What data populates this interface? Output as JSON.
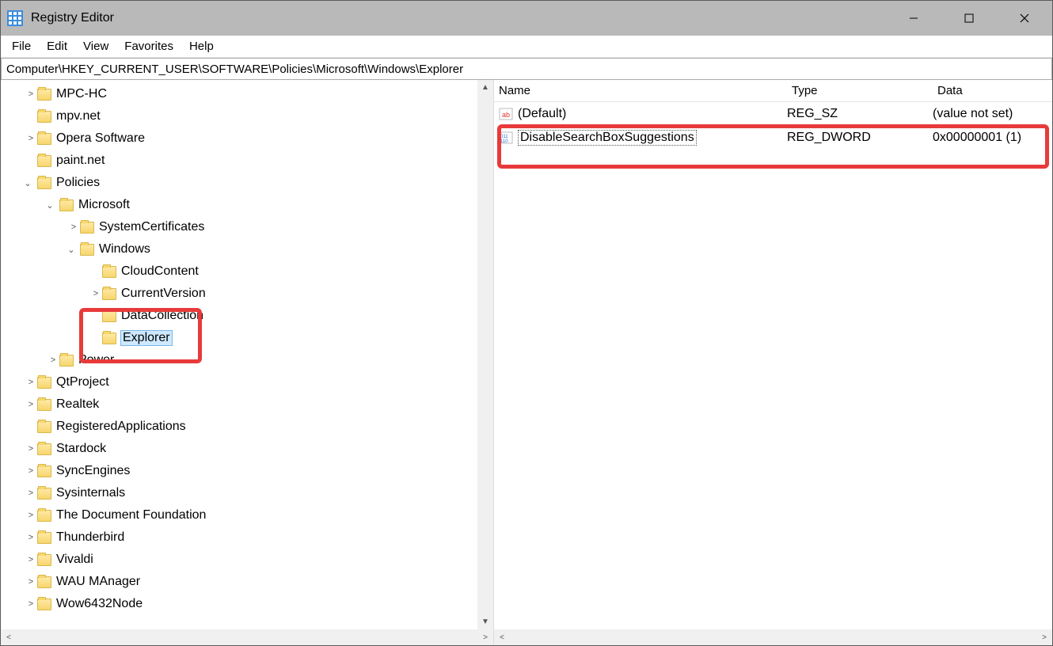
{
  "titlebar": {
    "title": "Registry Editor"
  },
  "menu": {
    "file": "File",
    "edit": "Edit",
    "view": "View",
    "favorites": "Favorites",
    "help": "Help"
  },
  "address": "Computer\\HKEY_CURRENT_USER\\SOFTWARE\\Policies\\Microsoft\\Windows\\Explorer",
  "tree": {
    "mpchc": "MPC-HC",
    "mpvnet": "mpv.net",
    "opera": "Opera Software",
    "paintnet": "paint.net",
    "policies": "Policies",
    "microsoft": "Microsoft",
    "syscert": "SystemCertificates",
    "windows": "Windows",
    "cloud": "CloudContent",
    "currver": "CurrentVersion",
    "datacoll": "DataCollection",
    "explorer": "Explorer",
    "power": "Power",
    "qtproject": "QtProject",
    "realtek": "Realtek",
    "regapps": "RegisteredApplications",
    "stardock": "Stardock",
    "syncengines": "SyncEngines",
    "sysinternals": "Sysinternals",
    "tdf": "The Document Foundation",
    "thunderbird": "Thunderbird",
    "vivaldi": "Vivaldi",
    "wau": "WAU MAnager",
    "wow64": "Wow6432Node"
  },
  "list": {
    "headers": {
      "name": "Name",
      "type": "Type",
      "data": "Data"
    },
    "rows": [
      {
        "name": "(Default)",
        "type": "REG_SZ",
        "data": "(value not set)"
      },
      {
        "name": "DisableSearchBoxSuggestions",
        "type": "REG_DWORD",
        "data": "0x00000001 (1)"
      }
    ]
  }
}
